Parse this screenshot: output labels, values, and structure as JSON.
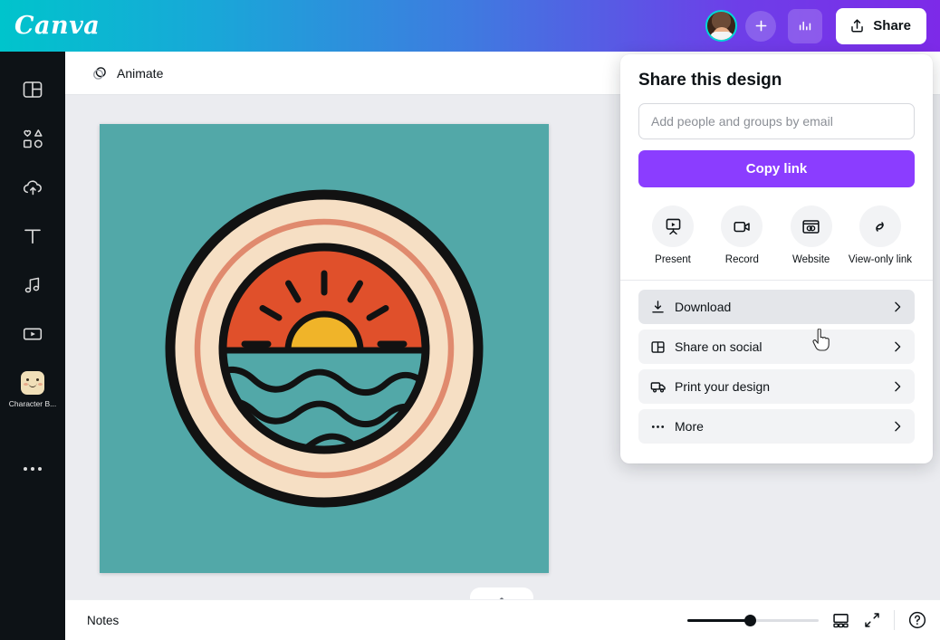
{
  "app": {
    "brand": "Canva"
  },
  "topbar": {
    "avatar_name": "user-avatar",
    "add_label": "+",
    "analytics_label": "Analytics",
    "share_label": "Share"
  },
  "sidebar": {
    "items": [
      {
        "icon": "design-panel-icon",
        "label": ""
      },
      {
        "icon": "elements-shapes-icon",
        "label": ""
      },
      {
        "icon": "upload-cloud-icon",
        "label": ""
      },
      {
        "icon": "text-type-icon",
        "label": ""
      },
      {
        "icon": "audio-music-icon",
        "label": ""
      },
      {
        "icon": "video-play-icon",
        "label": ""
      },
      {
        "icon": "character-builder-icon",
        "label": "Character B..."
      },
      {
        "icon": "more-dots-icon",
        "label": ""
      }
    ]
  },
  "toolbar": {
    "animate_label": "Animate"
  },
  "canvas": {
    "page_background": "#52a8a8",
    "artwork": {
      "name": "retro-sunset-badge",
      "outer_ring_color": "#f6dfc4",
      "accent_ring_color": "#e08a6e",
      "sky_color": "#e0502b",
      "sun_color": "#f0b429",
      "sea_color": "#52a8a8",
      "line_color": "#121212"
    }
  },
  "bottombar": {
    "notes_label": "Notes",
    "zoom_percent": 48,
    "grid_label": "Grid view",
    "fullscreen_label": "Fullscreen",
    "help_label": "Help"
  },
  "share_panel": {
    "title": "Share this design",
    "email_placeholder": "Add people and groups by email",
    "email_value": "",
    "copy_link_label": "Copy link",
    "copy_link_color": "#8b3dff",
    "quick_actions": [
      {
        "icon": "present-screen-icon",
        "label": "Present"
      },
      {
        "icon": "record-video-icon",
        "label": "Record"
      },
      {
        "icon": "website-browser-icon",
        "label": "Website"
      },
      {
        "icon": "view-only-link-icon",
        "label": "View-only link"
      }
    ],
    "menu_items": [
      {
        "icon": "download-icon",
        "label": "Download",
        "hovered": true
      },
      {
        "icon": "share-social-icon",
        "label": "Share on social",
        "hovered": false
      },
      {
        "icon": "print-truck-icon",
        "label": "Print your design",
        "hovered": false
      },
      {
        "icon": "more-dots-icon",
        "label": "More",
        "hovered": false
      }
    ]
  }
}
